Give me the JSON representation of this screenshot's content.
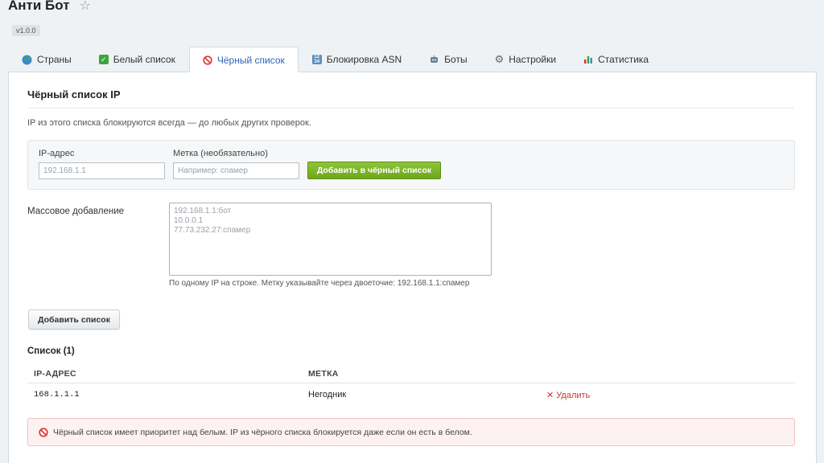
{
  "app": {
    "title": "Анти Бот",
    "version": "v1.0.0"
  },
  "tabs": [
    {
      "label": "Страны",
      "icon": "globe-icon"
    },
    {
      "label": "Белый список",
      "icon": "check-icon"
    },
    {
      "label": "Чёрный список",
      "icon": "prohibited-icon",
      "active": true
    },
    {
      "label": "Блокировка ASN",
      "icon": "numbers-icon"
    },
    {
      "label": "Боты",
      "icon": "bot-icon"
    },
    {
      "label": "Настройки",
      "icon": "gear-icon"
    },
    {
      "label": "Статистика",
      "icon": "bar-chart-icon"
    }
  ],
  "section": {
    "title": "Чёрный список IP",
    "description": "IP из этого списка блокируются всегда — до любых других проверок."
  },
  "add_form": {
    "ip_label": "IP-адрес",
    "ip_placeholder": "192.168.1.1",
    "tag_label": "Метка (необязательно)",
    "tag_placeholder": "Например: спамер",
    "submit_label": "Добавить в чёрный список"
  },
  "bulk": {
    "label": "Массовое добавление",
    "placeholder": "192.168.1.1:бот\n10.0.0.1\n77.73.232.27:спамер",
    "hint": "По одному IP на строке. Метку указывайте через двоеточие: 192.168.1.1:спамер",
    "submit_label": "Добавить список"
  },
  "list": {
    "title": "Список (1)",
    "columns": [
      "IP-АДРЕС",
      "МЕТКА"
    ],
    "rows": [
      {
        "ip": "168.1.1.1",
        "tag": "Негодник",
        "action": "✕ Удалить"
      }
    ]
  },
  "alert": {
    "text": "Чёрный список имеет приоритет над белым. IP из чёрного списка блокируется даже если он есть в белом."
  },
  "colors": {
    "accent": "#2a64b6",
    "success": "#7ab526",
    "danger": "#c8372d"
  }
}
